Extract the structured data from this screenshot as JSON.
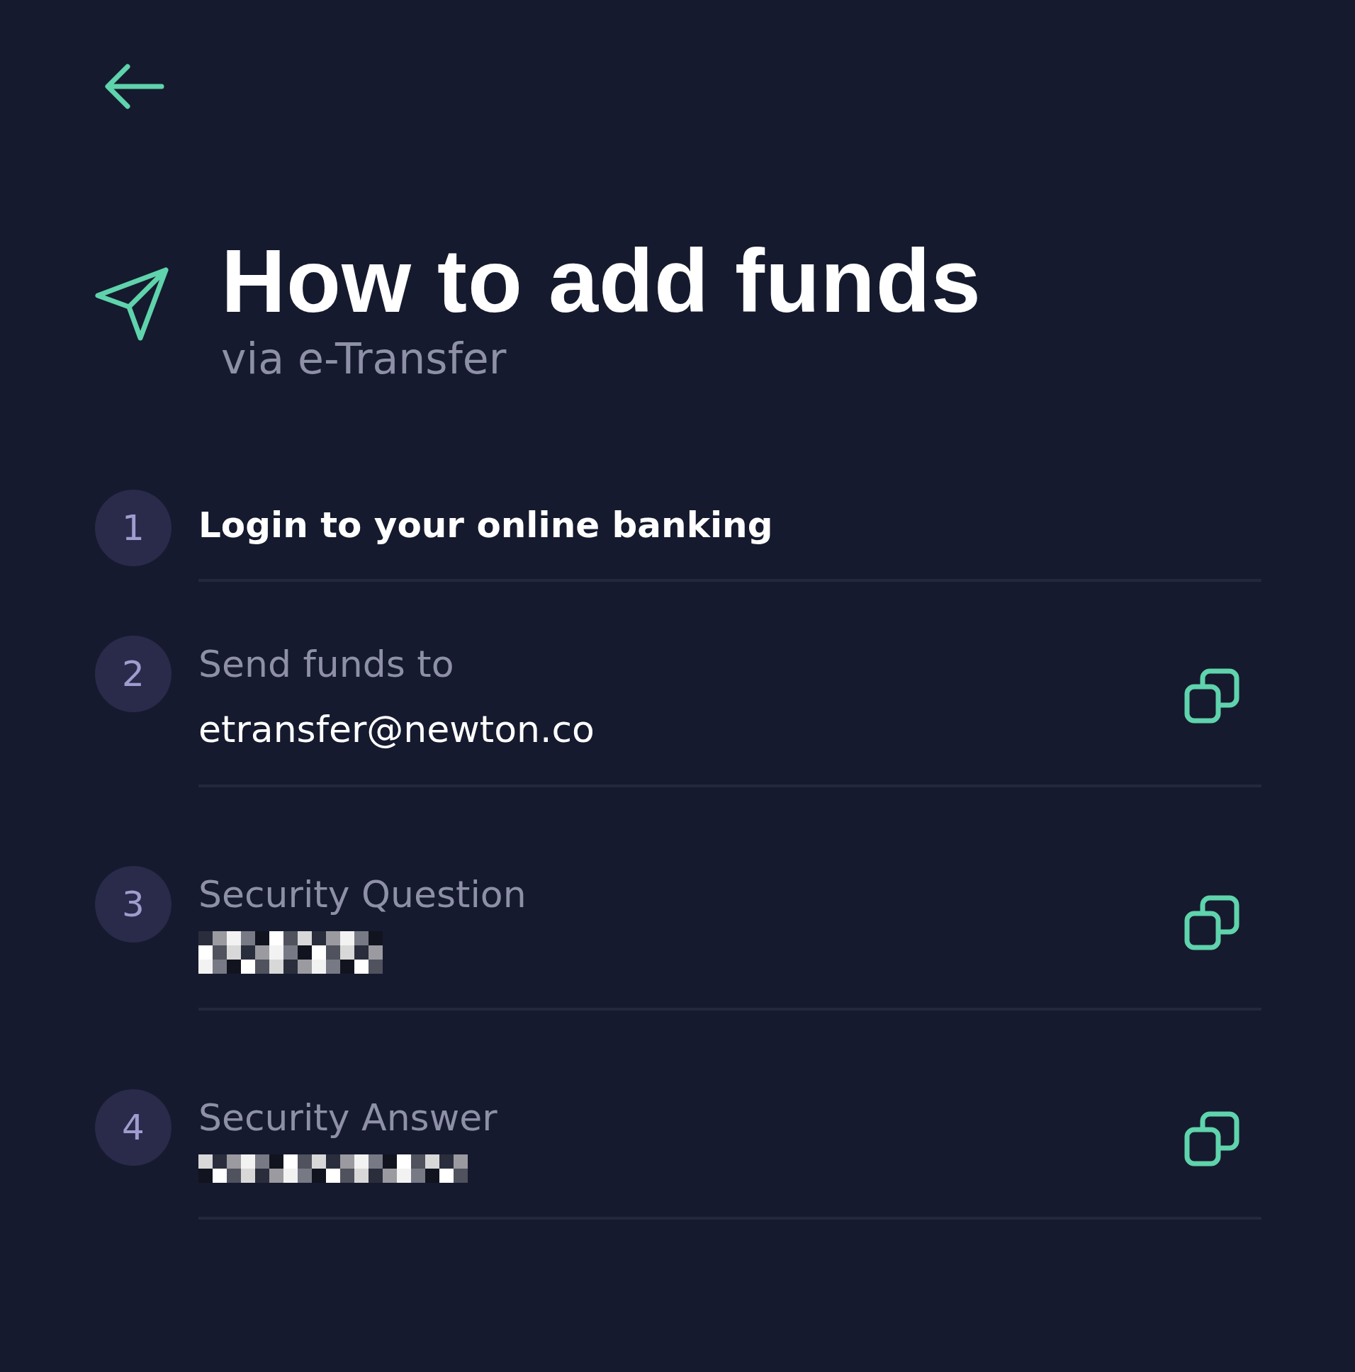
{
  "header": {
    "title": "How to add funds",
    "subtitle": "via e-Transfer"
  },
  "steps": [
    {
      "number": "1",
      "kind": "heading",
      "label": "Login to your online banking"
    },
    {
      "number": "2",
      "kind": "field",
      "label": "Send funds to",
      "value": "etransfer@newton.co"
    },
    {
      "number": "3",
      "kind": "redacted",
      "label": "Security Question"
    },
    {
      "number": "4",
      "kind": "redacted",
      "label": "Security Answer"
    }
  ]
}
